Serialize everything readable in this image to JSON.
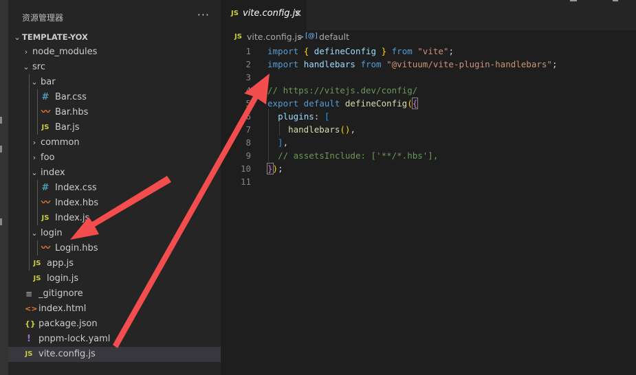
{
  "sidebar": {
    "title": "资源管理器",
    "more": "···",
    "root": "TEMPLATE-YOX",
    "items": [
      {
        "label": "node_modules",
        "kind": "folder",
        "state": "closed"
      },
      {
        "label": "src",
        "kind": "folder",
        "state": "open"
      },
      {
        "label": "bar",
        "kind": "folder",
        "state": "open"
      },
      {
        "label": "Bar.css",
        "kind": "css",
        "icon": "#"
      },
      {
        "label": "Bar.hbs",
        "kind": "hbs",
        "icon": "〰"
      },
      {
        "label": "Bar.js",
        "kind": "js",
        "icon": "JS"
      },
      {
        "label": "common",
        "kind": "folder",
        "state": "closed"
      },
      {
        "label": "foo",
        "kind": "folder",
        "state": "closed"
      },
      {
        "label": "index",
        "kind": "folder",
        "state": "open"
      },
      {
        "label": "Index.css",
        "kind": "css",
        "icon": "#"
      },
      {
        "label": "Index.hbs",
        "kind": "hbs",
        "icon": "〰"
      },
      {
        "label": "Index.js",
        "kind": "js",
        "icon": "JS"
      },
      {
        "label": "login",
        "kind": "folder",
        "state": "open"
      },
      {
        "label": "Login.hbs",
        "kind": "hbs",
        "icon": "〰"
      },
      {
        "label": "app.js",
        "kind": "js",
        "icon": "JS"
      },
      {
        "label": "login.js",
        "kind": "js",
        "icon": "JS"
      },
      {
        "label": "_gitignore",
        "kind": "git",
        "icon": "≡"
      },
      {
        "label": "index.html",
        "kind": "html",
        "icon": "<>"
      },
      {
        "label": "package.json",
        "kind": "json",
        "icon": "{}"
      },
      {
        "label": "pnpm-lock.yaml",
        "kind": "yaml",
        "icon": "!"
      },
      {
        "label": "vite.config.js",
        "kind": "js",
        "icon": "JS",
        "selected": true
      }
    ]
  },
  "tab": {
    "icon": "JS",
    "label": "vite.config.js",
    "close": "×"
  },
  "breadcrumb": {
    "icon": "JS",
    "file": "vite.config.js",
    "separator": ">",
    "symbol_icon": "[@]",
    "symbol": "default"
  },
  "editor": {
    "lines": [
      {
        "n": "1",
        "tokens": [
          [
            "kw",
            "import "
          ],
          [
            "br1",
            "{ "
          ],
          [
            "var",
            "defineConfig"
          ],
          [
            "br1",
            " }"
          ],
          [
            "kw",
            " from "
          ],
          [
            "str",
            "\"vite\""
          ],
          [
            "txt",
            ";"
          ]
        ]
      },
      {
        "n": "2",
        "tokens": [
          [
            "kw",
            "import "
          ],
          [
            "var",
            "handlebars"
          ],
          [
            "kw",
            " from "
          ],
          [
            "str",
            "\"@vituum/vite-plugin-handlebars\""
          ],
          [
            "txt",
            ";"
          ]
        ]
      },
      {
        "n": "3",
        "tokens": []
      },
      {
        "n": "4",
        "tokens": [
          [
            "com",
            "// https://vitejs.dev/config/"
          ]
        ]
      },
      {
        "n": "5",
        "tokens": [
          [
            "kw",
            "export default "
          ],
          [
            "fn",
            "defineConfig"
          ],
          [
            "br1",
            "("
          ],
          [
            "br2",
            "{"
          ]
        ]
      },
      {
        "n": "6",
        "tokens": [
          [
            "txt",
            "  "
          ],
          [
            "var",
            "plugins"
          ],
          [
            "txt",
            ": "
          ],
          [
            "br3",
            "["
          ]
        ]
      },
      {
        "n": "7",
        "tokens": [
          [
            "txt",
            "    "
          ],
          [
            "fn",
            "handlebars"
          ],
          [
            "br1",
            "()"
          ],
          [
            "txt",
            ","
          ]
        ]
      },
      {
        "n": "8",
        "tokens": [
          [
            "txt",
            "  "
          ],
          [
            "br3",
            "]"
          ],
          [
            "txt",
            ","
          ]
        ]
      },
      {
        "n": "9",
        "tokens": [
          [
            "txt",
            "  "
          ],
          [
            "com",
            "// assetsInclude: ['**/*.hbs'],"
          ]
        ]
      },
      {
        "n": "10",
        "tokens": [
          [
            "br2",
            "}"
          ],
          [
            "br1",
            ")"
          ],
          [
            "txt",
            ";"
          ]
        ]
      },
      {
        "n": "11",
        "tokens": []
      }
    ]
  },
  "colors": {
    "annotation_arrow": "#f44d4d",
    "selection": "#37373d",
    "keyword": "#569cd6",
    "string": "#ce9178",
    "comment": "#6a9955"
  }
}
